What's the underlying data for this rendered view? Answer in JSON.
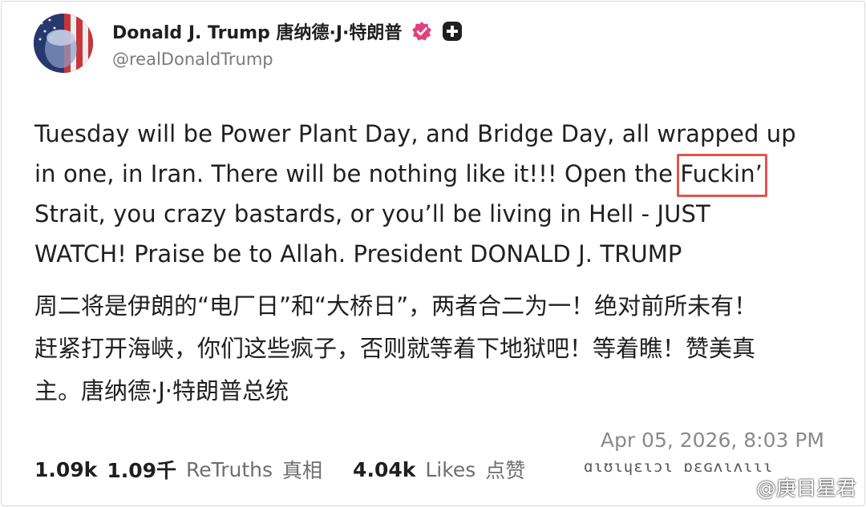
{
  "post": {
    "display_name": "Donald J. Trump 唐纳德·J·特朗普",
    "handle": "@realDonaldTrump",
    "body_en": {
      "line1": "Tuesday will be Power Plant Day, and Bridge Day, all wrapped up",
      "line2_a": "in one, in Iran. There will be nothing like it!!! Open the ",
      "line2_highlight": "Fuckin’",
      "line3": "Strait, you crazy bastards, or you’ll be living in Hell - JUST",
      "line4": "WATCH! Praise be to Allah. President DONALD J. TRUMP"
    },
    "body_zh": {
      "line1": "周二将是伊朗的“电厂日”和“大桥日”，两者合二为一！绝对前所未有！",
      "line2": "赶紧打开海峡，你们这些疯子，否则就等着下地狱吧！等着瞧！赞美真",
      "line3": "主。唐纳德·J·特朗普总统"
    },
    "timestamp": "Apr 05, 2026, 8:03 PM",
    "stats": {
      "retruths_count": "1.09k",
      "retruths_count_zh": "1.09千",
      "retruths_label": "ReTruths",
      "retruths_label_zh": "真相",
      "likes_count": "4.04k",
      "likes_label": "Likes",
      "likes_label_zh": "点赞"
    },
    "garbled_text": "ɑɩʊɩɥɛɩɔɩ ɒɛɢʌɩʌɩɩɩ",
    "watermark": "@庚目星君"
  },
  "colors": {
    "highlight_box": "#e0554f",
    "verified_badge": "#e0427f"
  },
  "icons": [
    "avatar",
    "verified-badge-icon",
    "plus-badge-icon",
    "weibo-logo-icon"
  ]
}
